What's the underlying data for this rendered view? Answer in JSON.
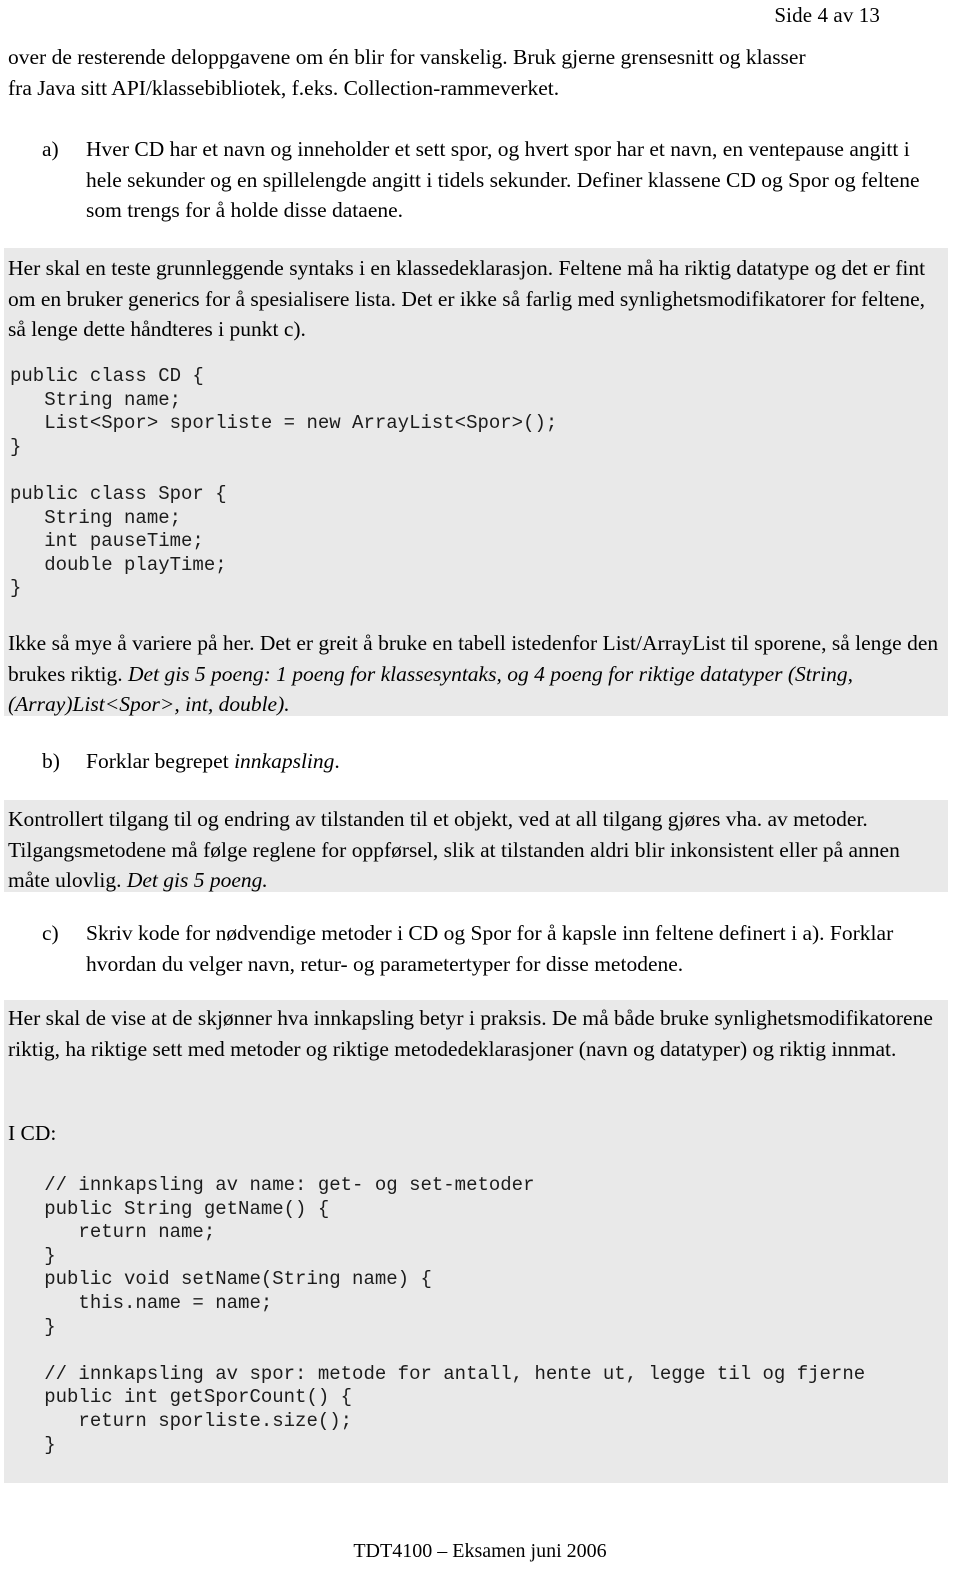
{
  "document": {
    "header": "Side 4 av 13",
    "footer": "TDT4100 – Eksamen juni 2006",
    "shading_color": "#e9e9e9",
    "text_color": "#000000"
  },
  "intro": {
    "line1": "over de resterende deloppgavene om én blir for vanskelig. Bruk gjerne grensesnitt og klasser",
    "line2": "fra Java sitt API/klassebibliotek, f.eks. Collection-rammeverket."
  },
  "tasks": [
    {
      "marker": "a)",
      "text": "Hver CD har et navn og inneholder et sett spor, og hvert spor har et navn, en ventepause angitt i hele sekunder og en spillelengde angitt i tidels sekunder. Definer klassene CD og Spor og feltene som trengs for å holde disse dataene."
    },
    {
      "marker": "b)",
      "text_plain": "Forklar begrepet ",
      "text_italic": "innkapsling",
      "text_tail": "."
    },
    {
      "marker": "c)",
      "text": "Skriv kode for nødvendige metoder i CD og Spor for å kapsle inn feltene definert i a). Forklar hvordan du velger navn, retur- og parametertyper for disse metodene."
    }
  ],
  "answers": {
    "a_intro": "Her skal en teste grunnleggende syntaks i en klassedeklarasjon. Feltene må ha riktig datatype og det er fint om en bruker generics for å spesialisere lista. Det er ikke så farlig med synlighetsmodifikatorer for feltene, så lenge dette håndteres i punkt c).",
    "a_code": "public class CD {\n   String name;\n   List<Spor> sporliste = new ArrayList<Spor>();\n}\n\npublic class Spor {\n   String name;\n   int pauseTime;\n   double playTime;\n}",
    "a_outro_plain": "Ikke så mye å variere på her. Det er greit å bruke en tabell istedenfor List/ArrayList til sporene, så lenge den brukes riktig. ",
    "a_outro_italic": "Det gis 5 poeng: 1 poeng for klassesyntaks, og 4 poeng for riktige datatyper (String, (Array)List<Spor>, int, double).",
    "b_answer_plain": "Kontrollert tilgang til og endring av tilstanden til et objekt, ved at all tilgang gjøres vha. av metoder. Tilgangsmetodene må følge reglene for oppførsel, slik at tilstanden aldri blir inkonsistent eller på annen måte ulovlig. ",
    "b_answer_italic": "Det gis 5 poeng.",
    "c_answer": "Her skal de vise at de skjønner hva innkapsling betyr i praksis. De må både bruke synlighetsmodifikatorene riktig, ha riktige sett med metoder og riktige metodedeklarasjoner (navn og datatyper) og riktig innmat.",
    "c_label": "I CD:",
    "c_code": "   // innkapsling av name: get- og set-metoder\n   public String getName() {\n      return name;\n   }\n   public void setName(String name) {\n      this.name = name;\n   }\n\n   // innkapsling av spor: metode for antall, hente ut, legge til og fjerne\n   public int getSporCount() {\n      return sporliste.size();\n   }"
  }
}
